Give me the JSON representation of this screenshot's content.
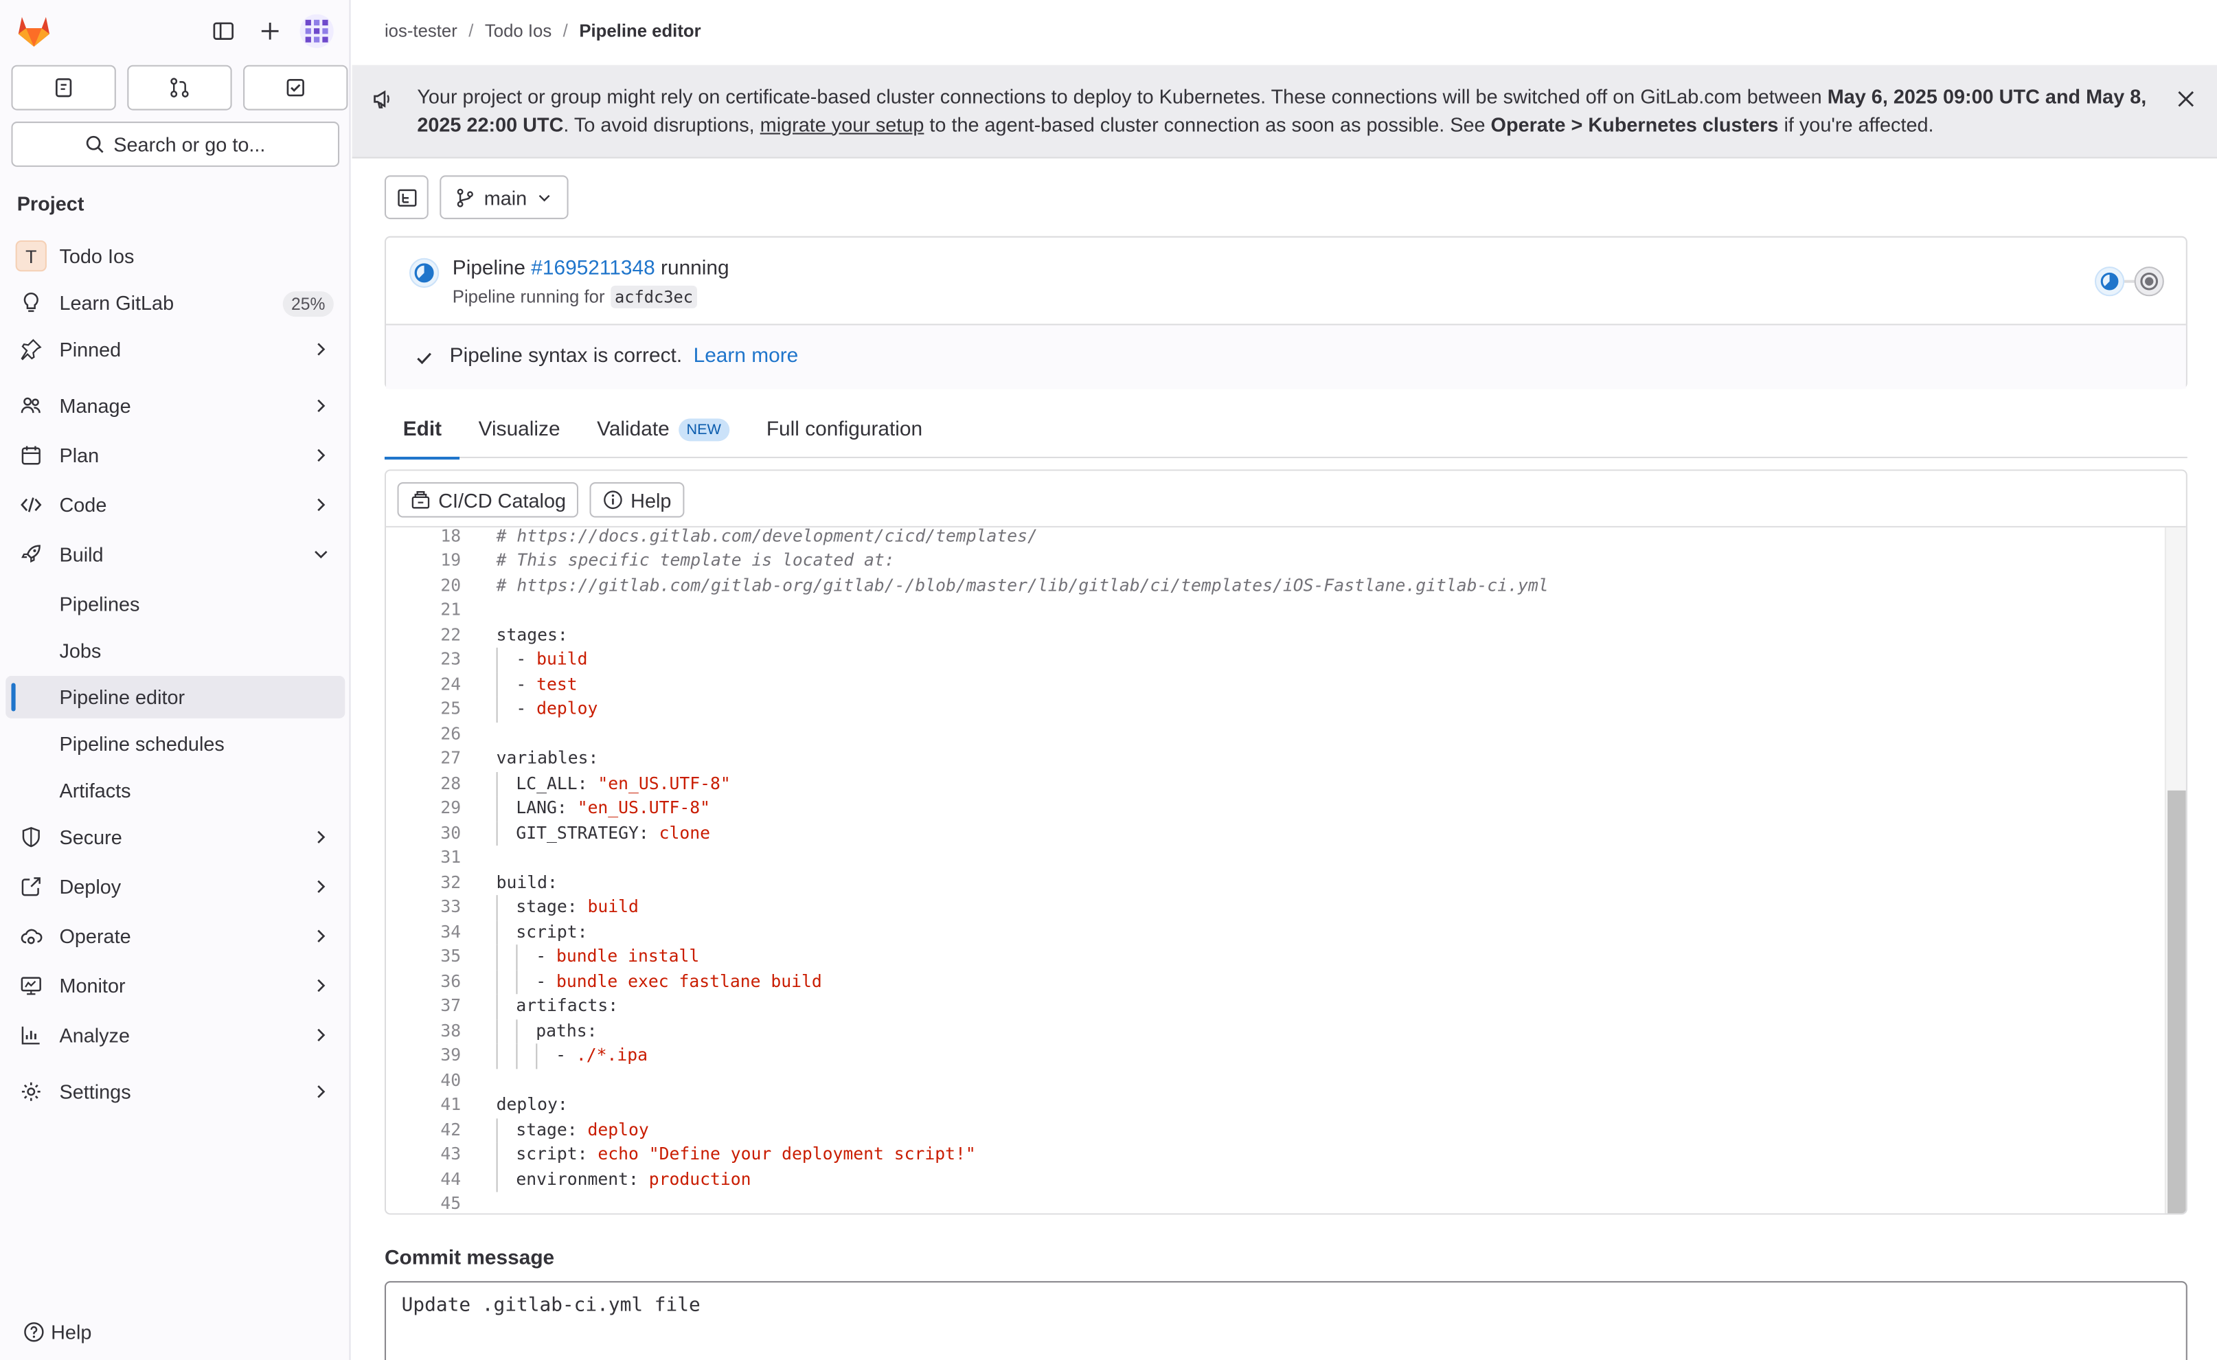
{
  "breadcrumb": [
    "ios-tester",
    "Todo Ios",
    "Pipeline editor"
  ],
  "search": {
    "label": "Search or go to..."
  },
  "sidebar": {
    "section": "Project",
    "project": {
      "letter": "T",
      "label": "Todo Ios"
    },
    "learn": {
      "label": "Learn GitLab",
      "badge": "25%"
    },
    "items": [
      {
        "label": "Pinned",
        "icon": "pin-icon"
      },
      {
        "label": "Manage",
        "icon": "users-icon"
      },
      {
        "label": "Plan",
        "icon": "calendar-icon"
      },
      {
        "label": "Code",
        "icon": "code-icon"
      },
      {
        "label": "Build",
        "icon": "rocket-icon"
      },
      {
        "label": "Pipelines"
      },
      {
        "label": "Jobs"
      },
      {
        "label": "Pipeline editor"
      },
      {
        "label": "Pipeline schedules"
      },
      {
        "label": "Artifacts"
      },
      {
        "label": "Secure",
        "icon": "shield-icon"
      },
      {
        "label": "Deploy",
        "icon": "deploy-icon"
      },
      {
        "label": "Operate",
        "icon": "cloud-gear-icon"
      },
      {
        "label": "Monitor",
        "icon": "monitor-icon"
      },
      {
        "label": "Analyze",
        "icon": "chart-icon"
      },
      {
        "label": "Settings",
        "icon": "gear-icon"
      }
    ],
    "help": "Help"
  },
  "banner": {
    "t1": "Your project or group might rely on certificate-based cluster connections to deploy to Kubernetes. These connections will be switched off on GitLab.com between ",
    "b1": "May 6, 2025 09:00 UTC and May 8, 2025 22:00 UTC",
    "t2": ". To avoid disruptions, ",
    "link": "migrate your setup",
    "t3": " to the agent-based cluster connection as soon as possible. See ",
    "b2": "Operate > Kubernetes clusters",
    "t4": " if you're affected."
  },
  "branch": "main",
  "pipeline": {
    "prefix": "Pipeline",
    "id": "#1695211348",
    "status": "running",
    "sub": "Pipeline running for",
    "sha": "acfdc3ec",
    "syntax": "Pipeline syntax is correct.",
    "learn_more": "Learn more"
  },
  "tabs": [
    {
      "label": "Edit"
    },
    {
      "label": "Visualize"
    },
    {
      "label": "Validate",
      "badge": "NEW"
    },
    {
      "label": "Full configuration"
    }
  ],
  "editor": {
    "catalog": "CI/CD Catalog",
    "help": "Help",
    "lines": [
      {
        "n": "18",
        "ind": 0,
        "parts": [
          {
            "t": "# ",
            "c": "cmt"
          },
          {
            "t": "https://docs.gitlab.com/development/cicd/templates/",
            "c": "cmt lnk"
          }
        ]
      },
      {
        "n": "19",
        "ind": 0,
        "parts": [
          {
            "t": "# This specific template is located at:",
            "c": "cmt"
          }
        ]
      },
      {
        "n": "20",
        "ind": 0,
        "parts": [
          {
            "t": "# ",
            "c": "cmt"
          },
          {
            "t": "https://gitlab.com/gitlab-org/gitlab/-/blob/master/lib/gitlab/ci/templates/iOS-Fastlane.gitlab-ci.yml",
            "c": "cmt lnk"
          }
        ]
      },
      {
        "n": "21",
        "ind": 0,
        "parts": []
      },
      {
        "n": "22",
        "ind": 0,
        "parts": [
          {
            "t": "stages:",
            "c": ""
          }
        ]
      },
      {
        "n": "23",
        "ind": 1,
        "parts": [
          {
            "t": "- ",
            "c": ""
          },
          {
            "t": "build",
            "c": "str"
          }
        ]
      },
      {
        "n": "24",
        "ind": 1,
        "parts": [
          {
            "t": "- ",
            "c": ""
          },
          {
            "t": "test",
            "c": "str"
          }
        ]
      },
      {
        "n": "25",
        "ind": 1,
        "parts": [
          {
            "t": "- ",
            "c": ""
          },
          {
            "t": "deploy",
            "c": "str"
          }
        ]
      },
      {
        "n": "26",
        "ind": 0,
        "parts": []
      },
      {
        "n": "27",
        "ind": 0,
        "parts": [
          {
            "t": "variables:",
            "c": ""
          }
        ]
      },
      {
        "n": "28",
        "ind": 1,
        "parts": [
          {
            "t": "LC_ALL: ",
            "c": ""
          },
          {
            "t": "\"en_US.UTF-8\"",
            "c": "str"
          }
        ]
      },
      {
        "n": "29",
        "ind": 1,
        "parts": [
          {
            "t": "LANG: ",
            "c": ""
          },
          {
            "t": "\"en_US.UTF-8\"",
            "c": "str"
          }
        ]
      },
      {
        "n": "30",
        "ind": 1,
        "parts": [
          {
            "t": "GIT_STRATEGY: ",
            "c": ""
          },
          {
            "t": "clone",
            "c": "str"
          }
        ]
      },
      {
        "n": "31",
        "ind": 0,
        "parts": []
      },
      {
        "n": "32",
        "ind": 0,
        "parts": [
          {
            "t": "build:",
            "c": ""
          }
        ]
      },
      {
        "n": "33",
        "ind": 1,
        "parts": [
          {
            "t": "stage: ",
            "c": ""
          },
          {
            "t": "build",
            "c": "str"
          }
        ]
      },
      {
        "n": "34",
        "ind": 1,
        "parts": [
          {
            "t": "script:",
            "c": ""
          }
        ]
      },
      {
        "n": "35",
        "ind": 2,
        "parts": [
          {
            "t": "- ",
            "c": ""
          },
          {
            "t": "bundle install",
            "c": "str"
          }
        ]
      },
      {
        "n": "36",
        "ind": 2,
        "parts": [
          {
            "t": "- ",
            "c": ""
          },
          {
            "t": "bundle exec fastlane build",
            "c": "str"
          }
        ]
      },
      {
        "n": "37",
        "ind": 1,
        "parts": [
          {
            "t": "artifacts:",
            "c": ""
          }
        ]
      },
      {
        "n": "38",
        "ind": 2,
        "parts": [
          {
            "t": "paths:",
            "c": ""
          }
        ]
      },
      {
        "n": "39",
        "ind": 3,
        "parts": [
          {
            "t": "- ",
            "c": ""
          },
          {
            "t": "./*.ipa",
            "c": "str"
          }
        ]
      },
      {
        "n": "40",
        "ind": 0,
        "parts": []
      },
      {
        "n": "41",
        "ind": 0,
        "parts": [
          {
            "t": "deploy:",
            "c": ""
          }
        ]
      },
      {
        "n": "42",
        "ind": 1,
        "parts": [
          {
            "t": "stage: ",
            "c": ""
          },
          {
            "t": "deploy",
            "c": "str"
          }
        ]
      },
      {
        "n": "43",
        "ind": 1,
        "parts": [
          {
            "t": "script: ",
            "c": ""
          },
          {
            "t": "echo \"Define your deployment script!\"",
            "c": "str"
          }
        ]
      },
      {
        "n": "44",
        "ind": 1,
        "parts": [
          {
            "t": "environment: ",
            "c": ""
          },
          {
            "t": "production",
            "c": "str"
          }
        ]
      },
      {
        "n": "45",
        "ind": 0,
        "parts": []
      }
    ]
  },
  "commit": {
    "label": "Commit message",
    "value": "Update .gitlab-ci.yml file"
  },
  "colors": {
    "accent": "#1f75cb",
    "string": "#c91c00",
    "comment": "#737278"
  }
}
